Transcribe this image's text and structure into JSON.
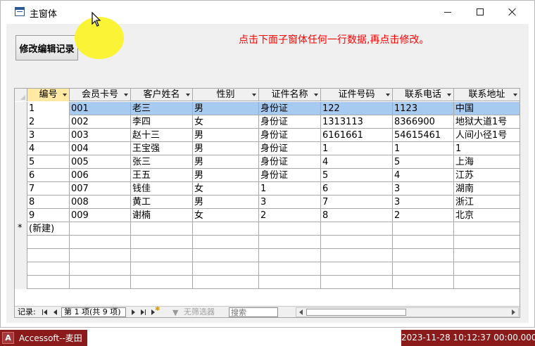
{
  "window": {
    "title": "主窗体"
  },
  "form": {
    "edit_button": "修改编辑记录",
    "hint": "点击下面子窗体任何一行数据,再点击修改。"
  },
  "table": {
    "columns": [
      "编号",
      "会员卡号",
      "客户姓名",
      "性别",
      "证件名称",
      "证件号码",
      "联系电话",
      "联系地址"
    ],
    "rows": [
      [
        "1",
        "001",
        "老三",
        "男",
        "身份证",
        "122",
        "1123",
        "中国"
      ],
      [
        "2",
        "002",
        "李四",
        "女",
        "身份证",
        "1313113",
        "8366900",
        "地狱大道1号"
      ],
      [
        "3",
        "003",
        "赵十三",
        "男",
        "身份证",
        "6161661",
        "54615461",
        "人间小径1号"
      ],
      [
        "4",
        "004",
        "王宝强",
        "男",
        "身份证",
        "1",
        "1",
        "1"
      ],
      [
        "5",
        "005",
        "张三",
        "男",
        "身份证",
        "4",
        "5",
        "上海"
      ],
      [
        "6",
        "006",
        "王五",
        "男",
        "身份证",
        "5",
        "4",
        "江苏"
      ],
      [
        "7",
        "007",
        "钱佳",
        "女",
        "1",
        "6",
        "3",
        "湖南"
      ],
      [
        "8",
        "008",
        "黄工",
        "男",
        "3",
        "7",
        "3",
        "浙江"
      ],
      [
        "9",
        "009",
        "谢楠",
        "女",
        "2",
        "8",
        "2",
        "北京"
      ]
    ],
    "new_row_marker": "*",
    "new_row_label": "(新建)"
  },
  "navigation": {
    "record_label": "记录:",
    "record_position": "第 1 项(共 9 项)",
    "filter_label": "无筛选器",
    "search_placeholder": "搜索"
  },
  "taskbar": {
    "app_label": "Accessoft--麦田",
    "app_icon_letter": "A",
    "datetime": "2023-11-28 10:12:37 00:00.000"
  },
  "colors": {
    "hint_text": "#ff0000",
    "selected_row": "#a6caf0",
    "active_header": "#ffe9a3",
    "taskbar_accent": "#8b1a1a",
    "cursor_highlight": "#fbf22b"
  },
  "icons": {
    "title": "form-icon",
    "minimize": "minimize-icon",
    "maximize": "maximize-icon",
    "close": "close-icon",
    "cursor": "mouse-pointer-icon",
    "filter": "funnel-icon",
    "app": "access-icon"
  }
}
